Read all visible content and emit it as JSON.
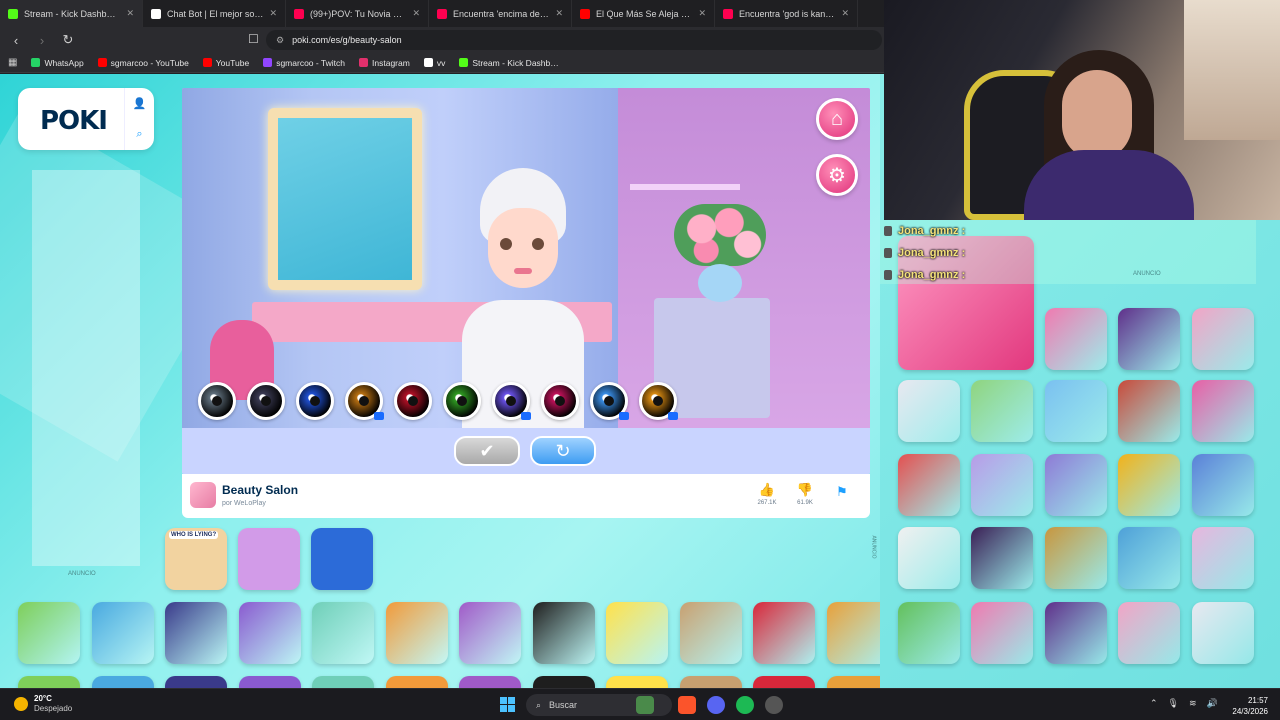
{
  "browser": {
    "tabs": [
      {
        "title": "Stream - Kick Dashboard",
        "color": "#53fc18"
      },
      {
        "title": "Chat Bot | El mejor software p…",
        "color": "#ffffff"
      },
      {
        "title": "(99+)POV: Tu Novia Busca el P…",
        "color": "#ff0050"
      },
      {
        "title": "Encuentra 'encima del yeski+'…",
        "color": "#ff0050"
      },
      {
        "title": "El Que Más Se Aleja En 7 Días…",
        "color": "#ff0000"
      },
      {
        "title": "Encuentra 'god is kanye west'…",
        "color": "#ff0050"
      }
    ],
    "url": "poki.com/es/g/beauty-salon",
    "bookmarks": [
      {
        "label": "WhatsApp",
        "color": "#25d366"
      },
      {
        "label": "sgmarcoo - YouTube",
        "color": "#ff0000"
      },
      {
        "label": "YouTube",
        "color": "#ff0000"
      },
      {
        "label": "sgmarcoo - Twitch",
        "color": "#9146ff"
      },
      {
        "label": "Instagram",
        "color": "#e1306c"
      },
      {
        "label": "vv",
        "color": "#ffffff"
      },
      {
        "label": "Stream - Kick Dashb…",
        "color": "#53fc18"
      }
    ]
  },
  "poki": {
    "logo": "POKI",
    "ad_label": "ANUNCIO"
  },
  "game": {
    "name": "Beauty Salon",
    "by": "por WeLoPlay",
    "likes": "267.1K",
    "dislikes": "61.9K",
    "eye_colors": [
      "#5f6f7c",
      "#3a3a52",
      "#1f4fd0",
      "#b87012",
      "#b01025",
      "#2f9a22",
      "#6a52e8",
      "#c0125a",
      "#3a8ee6",
      "#d88a12"
    ],
    "icons": {
      "home": "home-icon",
      "settings": "gear-icon",
      "confirm": "check-icon",
      "reset": "refresh-icon"
    }
  },
  "related_left": [
    {
      "label": "WHO IS LYING?",
      "color": "#f2d3a0"
    },
    {
      "label": "",
      "color": "#d29be8"
    },
    {
      "label": "",
      "color": "#2c6bd8"
    }
  ],
  "grid_right": [
    {
      "color": "#f07ab0"
    },
    {
      "color": "#5f2f8a"
    },
    {
      "color": "#f2a4c6"
    },
    {
      "color": "#e8e8f0"
    },
    {
      "color": "#8fd47e"
    },
    {
      "color": "#7ac0f0"
    },
    {
      "color": "#c84a3a"
    },
    {
      "color": "#e85fa6"
    },
    {
      "color": "#e45050"
    },
    {
      "color": "#b89be8"
    },
    {
      "color": "#8e7ad6"
    },
    {
      "color": "#f2b21a"
    },
    {
      "color": "#5a80d8"
    },
    {
      "color": "#f0f0f0"
    },
    {
      "color": "#3a1f55"
    },
    {
      "color": "#c8963e"
    },
    {
      "color": "#4ea0d8"
    },
    {
      "color": "#e7b6de"
    },
    {
      "color": "#63c05c"
    }
  ],
  "bottom_row": [
    {
      "color": "#7fcf5a"
    },
    {
      "color": "#4aa9e0"
    },
    {
      "color": "#3a3a8a"
    },
    {
      "color": "#8a5ad0"
    },
    {
      "color": "#6fcfb8"
    },
    {
      "color": "#f29a3a"
    },
    {
      "color": "#a05ac8"
    },
    {
      "color": "#1e1e1e"
    },
    {
      "color": "#ffe14a"
    },
    {
      "color": "#c8a070"
    },
    {
      "color": "#d8273a"
    },
    {
      "color": "#e8a03a"
    },
    {
      "color": "#2a7a2a"
    },
    {
      "color": "#f2c13a"
    },
    {
      "color": "#5abf4a"
    },
    {
      "color": "#3a2a2a"
    },
    {
      "color": "#f0e6e6"
    }
  ],
  "stream": {
    "chat": [
      {
        "user": "Jona_gmnz :"
      },
      {
        "user": "Jona_gmnz :"
      },
      {
        "user": "Jona_gmnz :"
      }
    ],
    "ad_label": "ANUNCIO"
  },
  "taskbar": {
    "temperature": "20°C",
    "weather": "Despejado",
    "search_placeholder": "Buscar",
    "time": "21:57",
    "date": "24/3/2026"
  }
}
